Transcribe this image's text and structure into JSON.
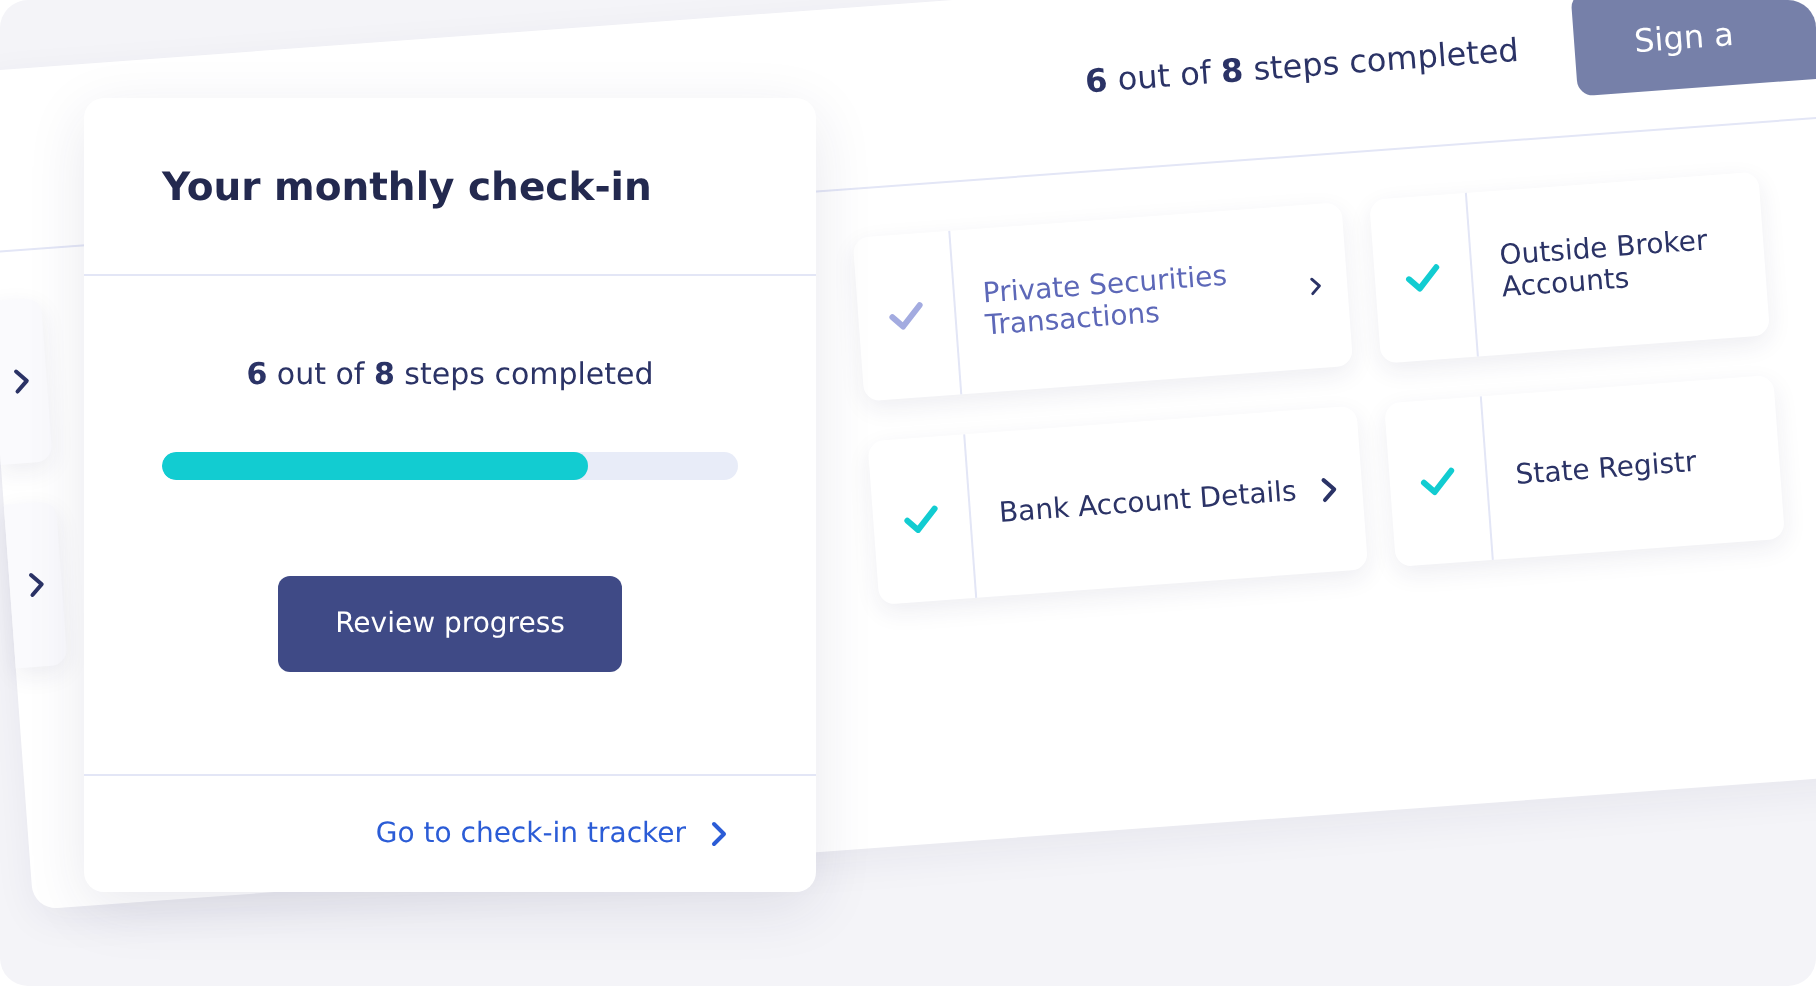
{
  "tracker": {
    "progress_text": "**6** out of **8** steps completed",
    "button": "Sign a",
    "steps": [
      {
        "label": "Private Securities Transactions",
        "color": "#a3abe0"
      },
      {
        "label": "Outside Broker Accounts",
        "color": "#12ccd1"
      },
      {
        "label": "Bank Account Details",
        "color": "#12ccd1"
      },
      {
        "label": "State Registr",
        "color": "#12ccd1"
      }
    ]
  },
  "card": {
    "title": "Your monthly check-in",
    "progress_text": "**6** out of **8** steps completed",
    "progress": {
      "level": 0.74
    },
    "button": "Review progress",
    "link": "Go to check-in tracker"
  }
}
